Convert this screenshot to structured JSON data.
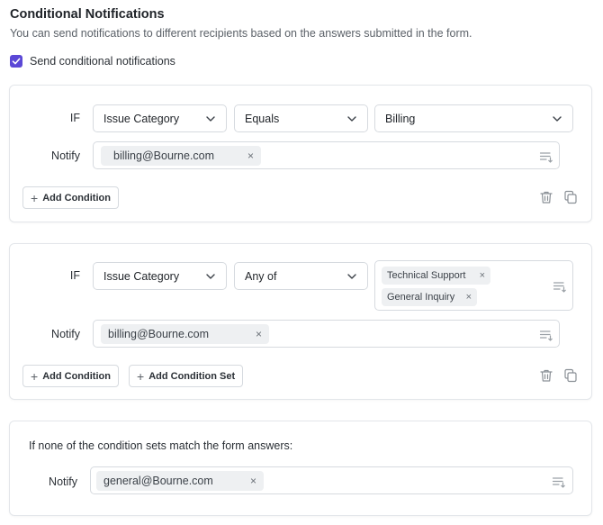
{
  "section": {
    "title": "Conditional Notifications",
    "subtitle": "You can send notifications to different recipients based on the answers submitted in the form."
  },
  "toggle": {
    "label": "Send conditional notifications",
    "checked": true
  },
  "labels": {
    "if": "IF",
    "notify": "Notify"
  },
  "condition_sets": [
    {
      "field": "Issue Category",
      "operator": "Equals",
      "value": "Billing",
      "notify": [
        "billing@Bourne.com"
      ],
      "add_condition_label": "Add Condition"
    },
    {
      "field": "Issue Category",
      "operator": "Any of",
      "values": [
        "Technical Support",
        "General Inquiry"
      ],
      "notify": [
        "billing@Bourne.com"
      ],
      "add_condition_label": "Add Condition",
      "add_condition_set_label": "Add Condition Set"
    }
  ],
  "fallback": {
    "text": "If none of the condition sets match the form answers:",
    "notify": [
      "general@Bourne.com"
    ]
  },
  "chip_remove": "×",
  "colors": {
    "accent": "#5b48d6",
    "border": "#d6dadf",
    "chip_bg": "#eef0f2"
  }
}
